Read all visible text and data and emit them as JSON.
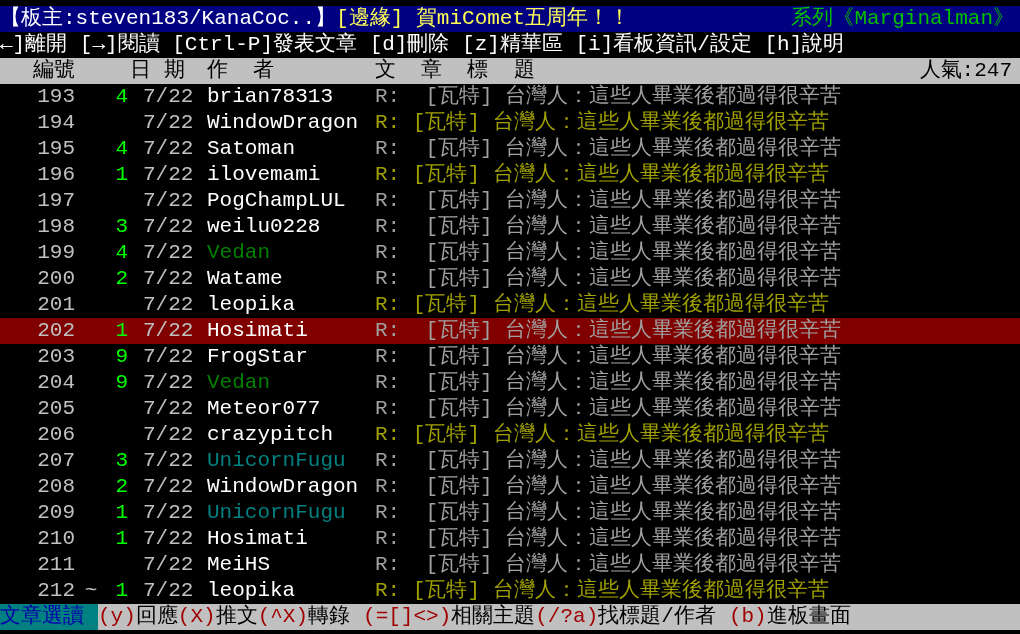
{
  "board_header": {
    "moderator": "【板主:steven183/KanaCoc..】",
    "board_title": "[邊緣] 賀miComet五周年！！",
    "series": "系列《Marginalman》"
  },
  "key_hints": "←]離開 [→]閱讀 [Ctrl-P]發表文章 [d]刪除 [z]精華區 [i]看板資訊/設定 [h]說明",
  "columns": [
    "編號",
    "日 期",
    "作  者",
    "文  章  標  題"
  ],
  "popularity": "人氣:247",
  "rows": [
    {
      "number": "193",
      "mark": "",
      "pushes": "4",
      "date": "7/22",
      "author": {
        "name": "brian78313",
        "color": "#ffffff"
      },
      "title": "R:  [瓦特] 台灣人：這些人畢業後都過得很辛苦",
      "highlighted": false,
      "selected": false
    },
    {
      "number": "194",
      "mark": "",
      "pushes": "",
      "date": "7/22",
      "author": {
        "name": "WindowDragon",
        "color": "#ffffff"
      },
      "title": "R: [瓦特] 台灣人：這些人畢業後都過得很辛苦",
      "highlighted": true,
      "selected": false
    },
    {
      "number": "195",
      "mark": "",
      "pushes": "4",
      "date": "7/22",
      "author": {
        "name": "Satoman",
        "color": "#ffffff"
      },
      "title": "R:  [瓦特] 台灣人：這些人畢業後都過得很辛苦",
      "highlighted": false,
      "selected": false
    },
    {
      "number": "196",
      "mark": "",
      "pushes": "1",
      "date": "7/22",
      "author": {
        "name": "ilovemami",
        "color": "#ffffff"
      },
      "title": "R: [瓦特] 台灣人：這些人畢業後都過得很辛苦",
      "highlighted": true,
      "selected": false
    },
    {
      "number": "197",
      "mark": "",
      "pushes": "",
      "date": "7/22",
      "author": {
        "name": "PogChampLUL",
        "color": "#ffffff"
      },
      "title": "R:  [瓦特] 台灣人：這些人畢業後都過得很辛苦",
      "highlighted": false,
      "selected": false
    },
    {
      "number": "198",
      "mark": "",
      "pushes": "3",
      "date": "7/22",
      "author": {
        "name": "weilu0228",
        "color": "#ffffff"
      },
      "title": "R:  [瓦特] 台灣人：這些人畢業後都過得很辛苦",
      "highlighted": false,
      "selected": false
    },
    {
      "number": "199",
      "mark": "",
      "pushes": "4",
      "date": "7/22",
      "author": {
        "name": "Vedan",
        "color": "#008000"
      },
      "title": "R:  [瓦特] 台灣人：這些人畢業後都過得很辛苦",
      "highlighted": false,
      "selected": false
    },
    {
      "number": "200",
      "mark": "",
      "pushes": "2",
      "date": "7/22",
      "author": {
        "name": "Watame",
        "color": "#ffffff"
      },
      "title": "R:  [瓦特] 台灣人：這些人畢業後都過得很辛苦",
      "highlighted": false,
      "selected": false
    },
    {
      "number": "201",
      "mark": "",
      "pushes": "",
      "date": "7/22",
      "author": {
        "name": "leopika",
        "color": "#ffffff"
      },
      "title": "R: [瓦特] 台灣人：這些人畢業後都過得很辛苦",
      "highlighted": true,
      "selected": false
    },
    {
      "number": "202",
      "mark": "",
      "pushes": "1",
      "date": "7/22",
      "author": {
        "name": "Hosimati",
        "color": "#ffffff"
      },
      "title": "R:  [瓦特] 台灣人：這些人畢業後都過得很辛苦",
      "highlighted": false,
      "selected": true
    },
    {
      "number": "203",
      "mark": "",
      "pushes": "9",
      "date": "7/22",
      "author": {
        "name": "FrogStar",
        "color": "#ffffff"
      },
      "title": "R:  [瓦特] 台灣人：這些人畢業後都過得很辛苦",
      "highlighted": false,
      "selected": false
    },
    {
      "number": "204",
      "mark": "",
      "pushes": "9",
      "date": "7/22",
      "author": {
        "name": "Vedan",
        "color": "#008000"
      },
      "title": "R:  [瓦特] 台灣人：這些人畢業後都過得很辛苦",
      "highlighted": false,
      "selected": false
    },
    {
      "number": "205",
      "mark": "",
      "pushes": "",
      "date": "7/22",
      "author": {
        "name": "Meteor077",
        "color": "#ffffff"
      },
      "title": "R:  [瓦特] 台灣人：這些人畢業後都過得很辛苦",
      "highlighted": false,
      "selected": false
    },
    {
      "number": "206",
      "mark": "",
      "pushes": "",
      "date": "7/22",
      "author": {
        "name": "crazypitch",
        "color": "#ffffff"
      },
      "title": "R: [瓦特] 台灣人：這些人畢業後都過得很辛苦",
      "highlighted": true,
      "selected": false
    },
    {
      "number": "207",
      "mark": "",
      "pushes": "3",
      "date": "7/22",
      "author": {
        "name": "UnicornFugu",
        "color": "#008080"
      },
      "title": "R:  [瓦特] 台灣人：這些人畢業後都過得很辛苦",
      "highlighted": false,
      "selected": false
    },
    {
      "number": "208",
      "mark": "",
      "pushes": "2",
      "date": "7/22",
      "author": {
        "name": "WindowDragon",
        "color": "#ffffff"
      },
      "title": "R:  [瓦特] 台灣人：這些人畢業後都過得很辛苦",
      "highlighted": false,
      "selected": false
    },
    {
      "number": "209",
      "mark": "",
      "pushes": "1",
      "date": "7/22",
      "author": {
        "name": "UnicornFugu",
        "color": "#008080"
      },
      "title": "R:  [瓦特] 台灣人：這些人畢業後都過得很辛苦",
      "highlighted": false,
      "selected": false
    },
    {
      "number": "210",
      "mark": "",
      "pushes": "1",
      "date": "7/22",
      "author": {
        "name": "Hosimati",
        "color": "#ffffff"
      },
      "title": "R:  [瓦特] 台灣人：這些人畢業後都過得很辛苦",
      "highlighted": false,
      "selected": false
    },
    {
      "number": "211",
      "mark": "",
      "pushes": "",
      "date": "7/22",
      "author": {
        "name": "MeiHS",
        "color": "#ffffff"
      },
      "title": "R:  [瓦特] 台灣人：這些人畢業後都過得很辛苦",
      "highlighted": false,
      "selected": false
    },
    {
      "number": "212",
      "mark": "~",
      "pushes": "1",
      "date": "7/22",
      "author": {
        "name": "leopika",
        "color": "#ffffff"
      },
      "title": "R: [瓦特] 台灣人：這些人畢業後都過得很辛苦",
      "highlighted": true,
      "selected": false
    }
  ],
  "status_bar": {
    "mode": "文章選讀",
    "hints": [
      {
        "key": "(y)",
        "label": "回應"
      },
      {
        "key": "(X)",
        "label": "推文"
      },
      {
        "key": "(^X)",
        "label": "轉錄"
      },
      {
        "key": "(=[]<>)",
        "label": "相關主題"
      },
      {
        "key": "(/?a)",
        "label": "找標題/作者"
      },
      {
        "key": "(b)",
        "label": "進板畫面"
      }
    ]
  }
}
